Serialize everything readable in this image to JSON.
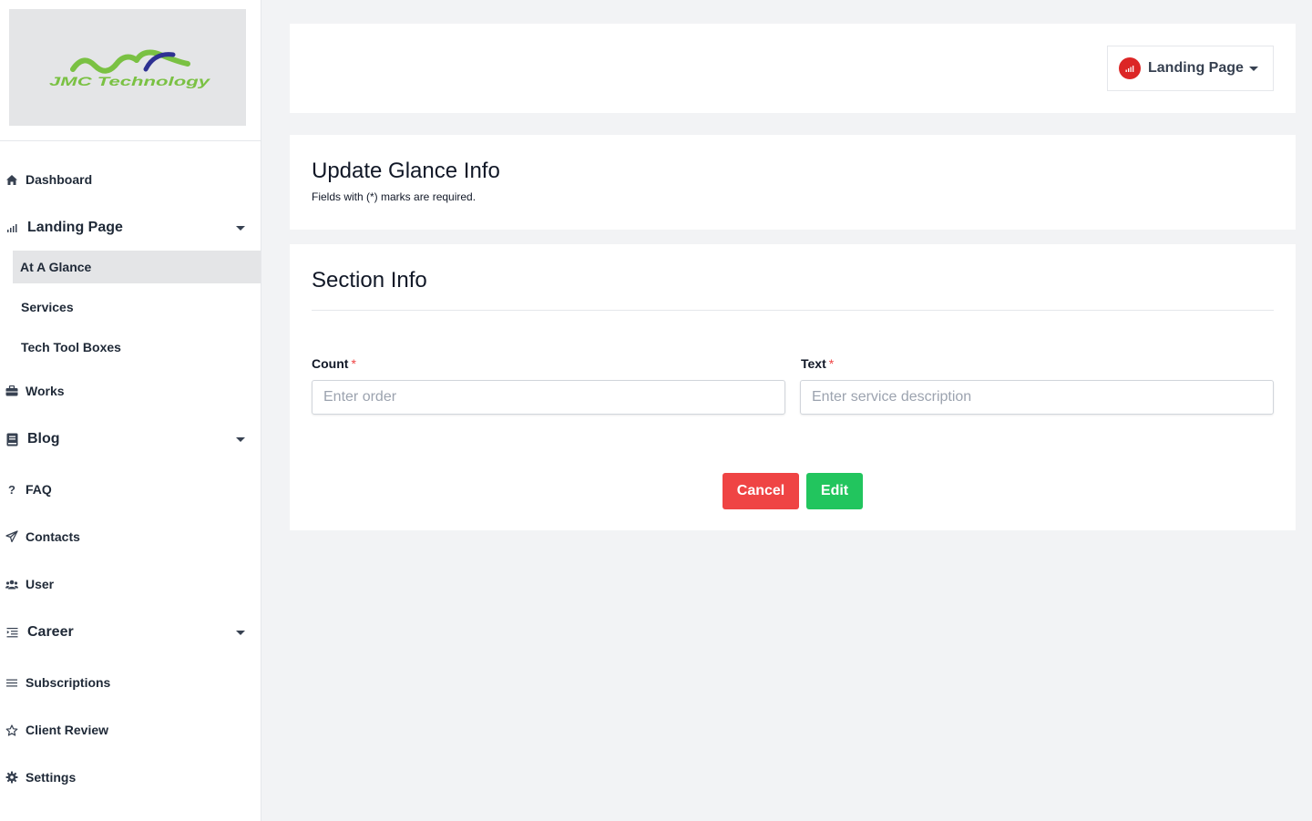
{
  "sidebar": {
    "logo": {
      "text": "JMC Technology",
      "alt": "JMC Technology logo"
    },
    "items": [
      {
        "label": "Dashboard",
        "icon": "home-icon"
      },
      {
        "label": "Landing Page",
        "icon": "signal-bars-icon",
        "expanded": true
      },
      {
        "label": "Works",
        "icon": "briefcase-icon"
      },
      {
        "label": "Blog",
        "icon": "book-icon"
      },
      {
        "label": "FAQ",
        "icon": "question-icon"
      },
      {
        "label": "Contacts",
        "icon": "paper-plane-icon"
      },
      {
        "label": "User",
        "icon": "users-icon"
      },
      {
        "label": "Career",
        "icon": "list-indent-icon"
      },
      {
        "label": "Subscriptions",
        "icon": "menu-lines-icon"
      },
      {
        "label": "Client Review",
        "icon": "star-icon"
      },
      {
        "label": "Settings",
        "icon": "gear-icon"
      }
    ],
    "landing_sub": [
      {
        "label": "At A Glance",
        "active": true
      },
      {
        "label": "Services"
      },
      {
        "label": "Tech Tool Boxes"
      }
    ]
  },
  "topbar": {
    "page_menu_label": "Landing Page"
  },
  "header_card": {
    "title": "Update Glance Info",
    "subtitle": "Fields with (*) marks are required."
  },
  "form": {
    "section_title": "Section Info",
    "count": {
      "label": "Count",
      "required_mark": "*",
      "placeholder": "Enter order",
      "value": ""
    },
    "text": {
      "label": "Text",
      "required_mark": "*",
      "placeholder": "Enter service description",
      "value": ""
    },
    "cancel_label": "Cancel",
    "edit_label": "Edit"
  },
  "colors": {
    "cancel": "#ef4444",
    "edit": "#22c55e",
    "badge": "#dc2626",
    "logo_green": "#7ac143",
    "logo_blue": "#2e3192"
  }
}
